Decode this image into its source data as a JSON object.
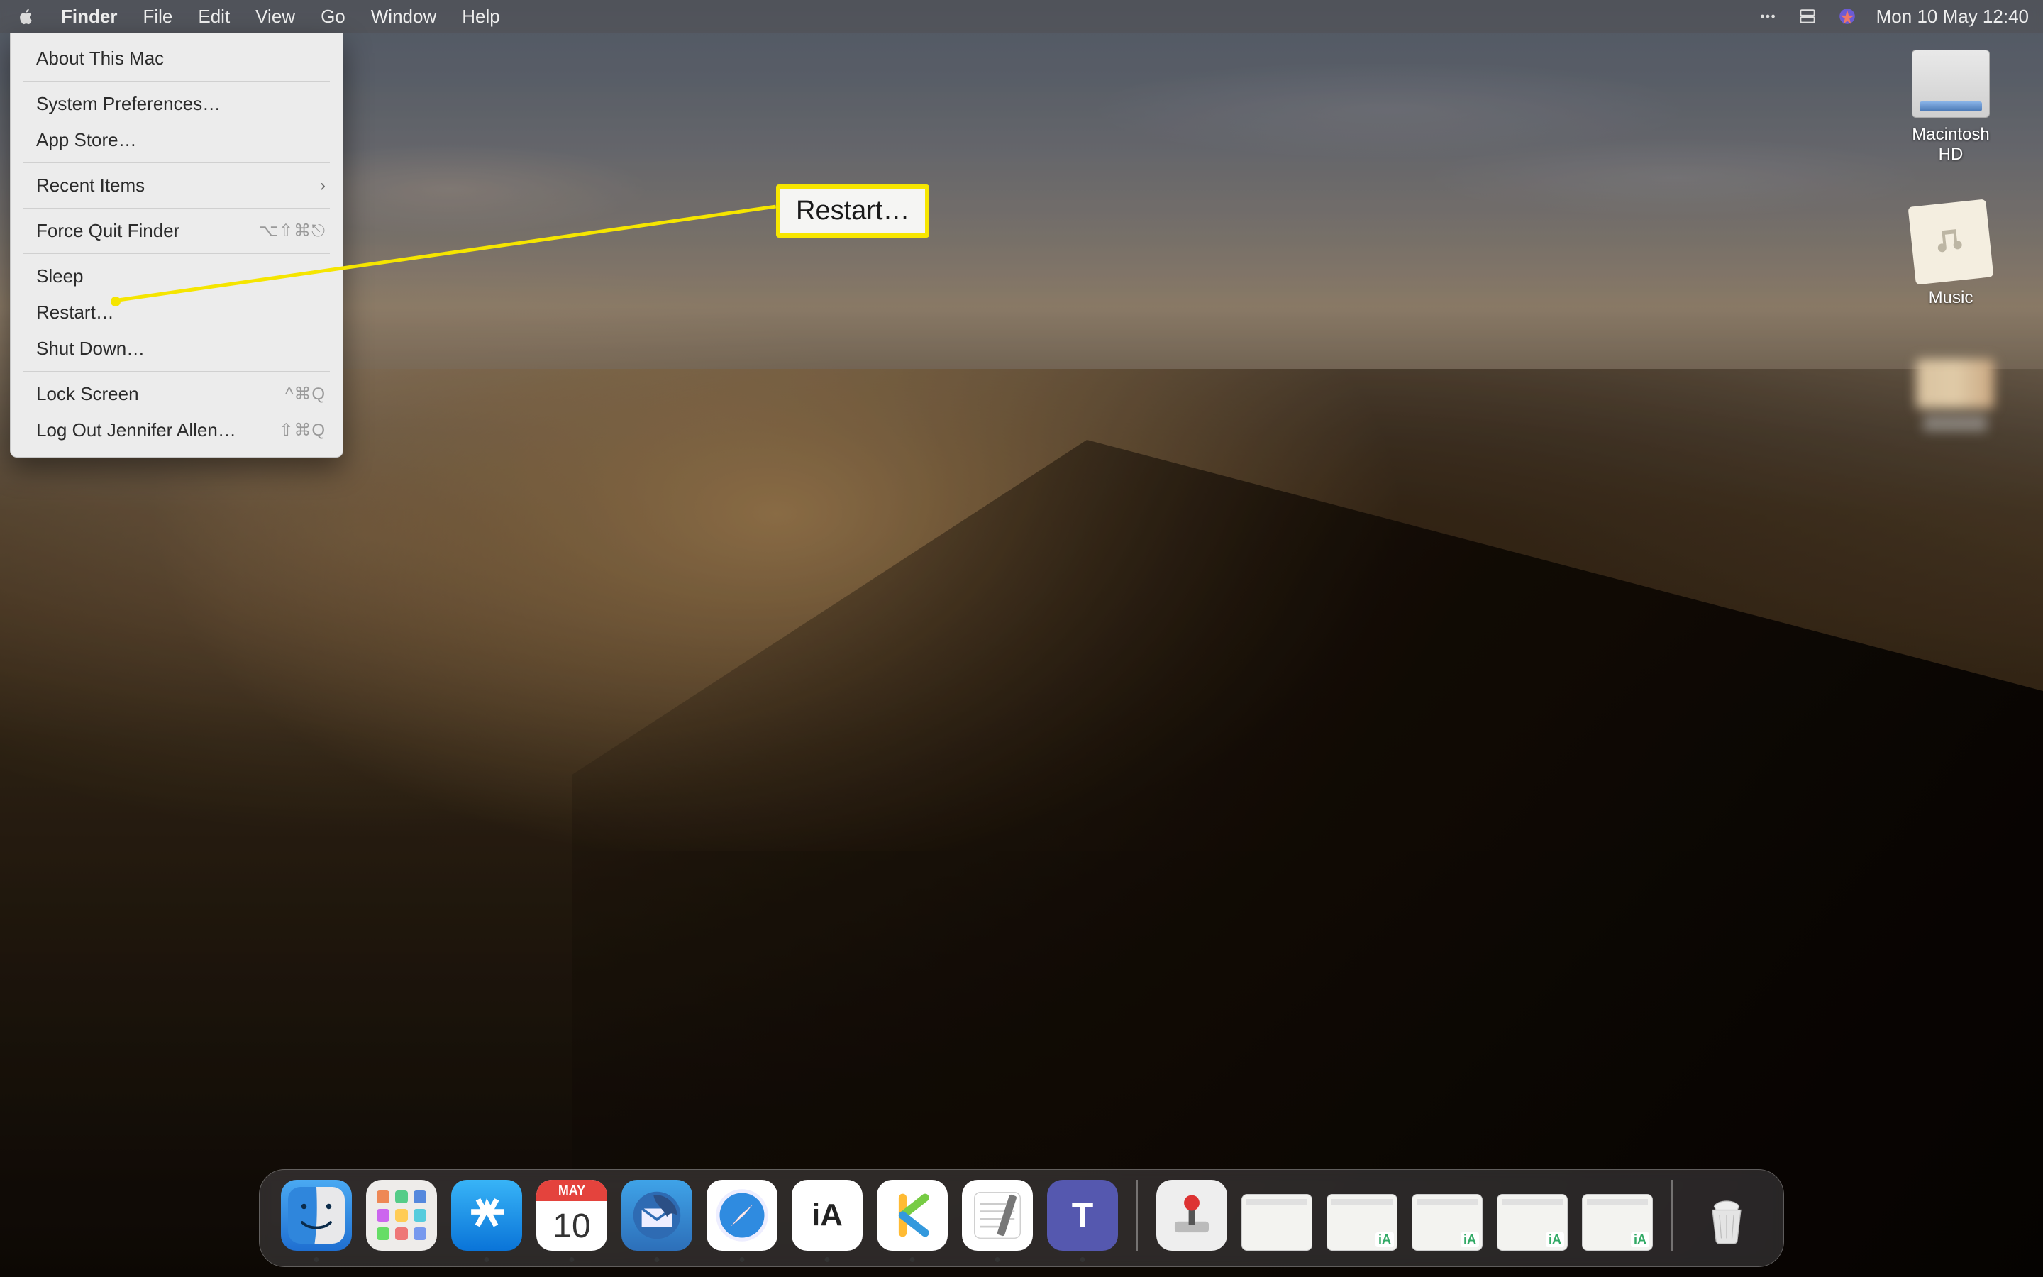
{
  "menubar": {
    "app_name": "Finder",
    "items": [
      "File",
      "Edit",
      "View",
      "Go",
      "Window",
      "Help"
    ],
    "clock": "Mon 10 May  12:40"
  },
  "apple_menu": {
    "about": "About This Mac",
    "sysprefs": "System Preferences…",
    "appstore": "App Store…",
    "recent": "Recent Items",
    "force_quit": "Force Quit Finder",
    "force_quit_shortcut": "⌥⇧⌘⎋",
    "sleep": "Sleep",
    "restart": "Restart…",
    "shutdown": "Shut Down…",
    "lock": "Lock Screen",
    "lock_shortcut": "^⌘Q",
    "logout": "Log Out Jennifer Allen…",
    "logout_shortcut": "⇧⌘Q"
  },
  "callout": {
    "label": "Restart…"
  },
  "desktop_icons": {
    "hdd": "Macintosh HD",
    "music": "Music",
    "blurred": ""
  },
  "dock": {
    "cal_month": "MAY",
    "cal_day": "10",
    "ia_label": "iA",
    "teams_label": "T",
    "mini_tag": "iA"
  }
}
